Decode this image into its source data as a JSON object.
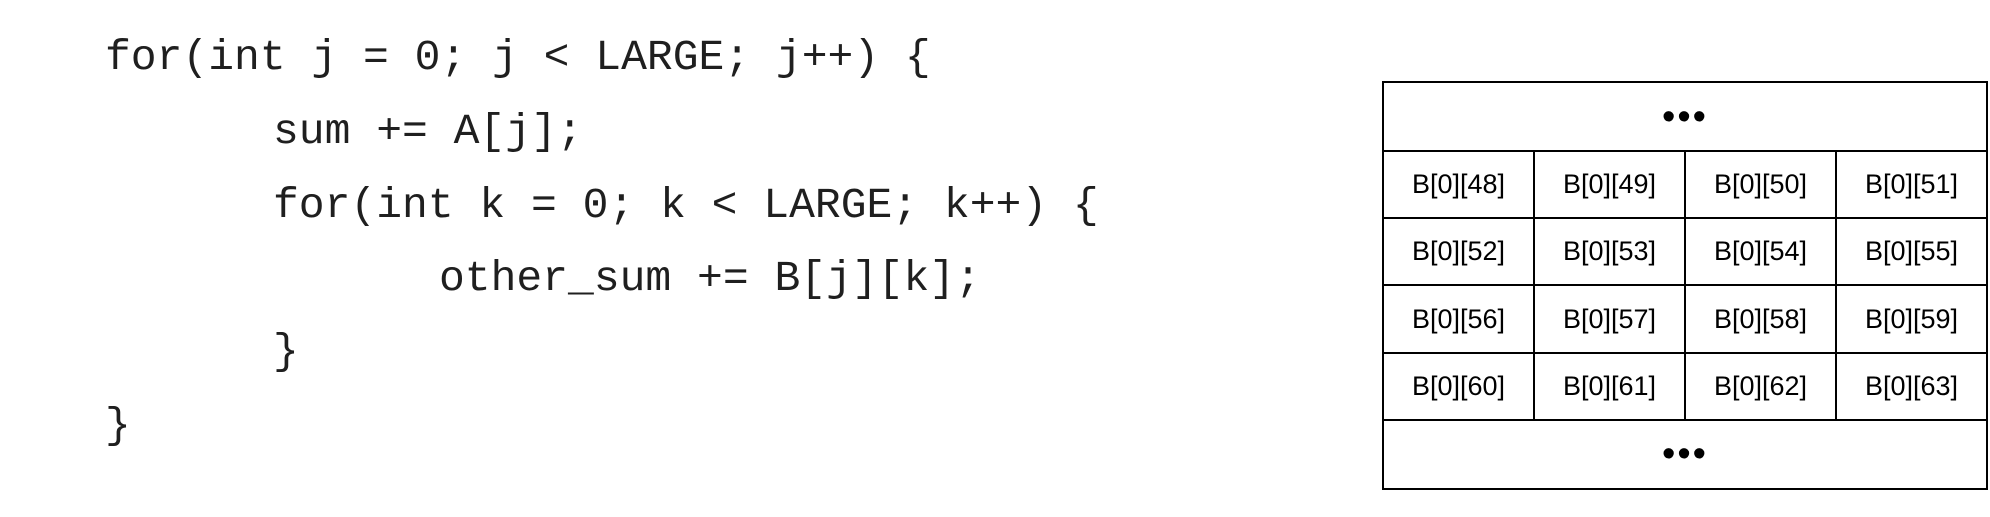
{
  "code": {
    "lines": [
      "for(int j = 0; j < LARGE; j++) {",
      "sum += A[j];",
      "for(int k = 0; k < LARGE; k++) {",
      "other_sum += B[j][k];",
      "}",
      "}"
    ]
  },
  "memory_table": {
    "top_ellipsis": "•••",
    "rows": [
      [
        "B[0][48]",
        "B[0][49]",
        "B[0][50]",
        "B[0][51]"
      ],
      [
        "B[0][52]",
        "B[0][53]",
        "B[0][54]",
        "B[0][55]"
      ],
      [
        "B[0][56]",
        "B[0][57]",
        "B[0][58]",
        "B[0][59]"
      ],
      [
        "B[0][60]",
        "B[0][61]",
        "B[0][62]",
        "B[0][63]"
      ]
    ],
    "bottom_ellipsis": "•••"
  }
}
